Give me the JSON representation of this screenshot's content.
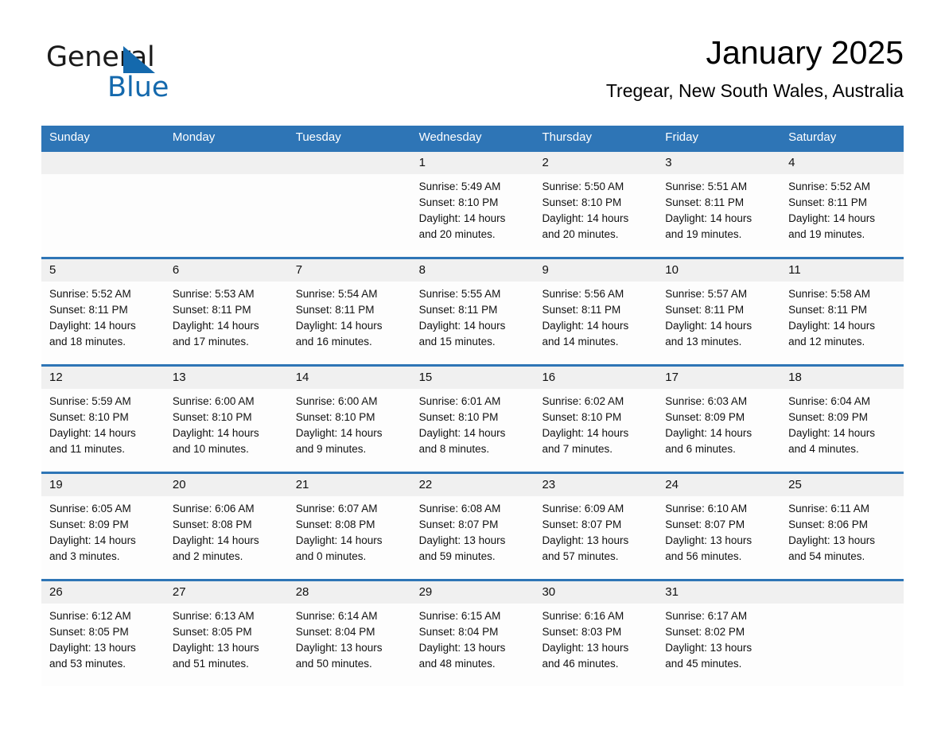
{
  "brand": {
    "name_part1": "General",
    "name_part2": "Blue",
    "triangle_color": "#1469ad"
  },
  "header": {
    "title": "January 2025",
    "location": "Tregear, New South Wales, Australia"
  },
  "theme": {
    "header_blue": "#2e75b6",
    "daynum_band": "#f0f0f0",
    "cell_bg": "#fdfdfd",
    "text": "#111111"
  },
  "weekday_headers": [
    "Sunday",
    "Monday",
    "Tuesday",
    "Wednesday",
    "Thursday",
    "Friday",
    "Saturday"
  ],
  "weeks": [
    [
      {
        "day": "",
        "lines": []
      },
      {
        "day": "",
        "lines": []
      },
      {
        "day": "",
        "lines": []
      },
      {
        "day": "1",
        "lines": [
          "Sunrise: 5:49 AM",
          "Sunset: 8:10 PM",
          "Daylight: 14 hours",
          "and 20 minutes."
        ]
      },
      {
        "day": "2",
        "lines": [
          "Sunrise: 5:50 AM",
          "Sunset: 8:10 PM",
          "Daylight: 14 hours",
          "and 20 minutes."
        ]
      },
      {
        "day": "3",
        "lines": [
          "Sunrise: 5:51 AM",
          "Sunset: 8:11 PM",
          "Daylight: 14 hours",
          "and 19 minutes."
        ]
      },
      {
        "day": "4",
        "lines": [
          "Sunrise: 5:52 AM",
          "Sunset: 8:11 PM",
          "Daylight: 14 hours",
          "and 19 minutes."
        ]
      }
    ],
    [
      {
        "day": "5",
        "lines": [
          "Sunrise: 5:52 AM",
          "Sunset: 8:11 PM",
          "Daylight: 14 hours",
          "and 18 minutes."
        ]
      },
      {
        "day": "6",
        "lines": [
          "Sunrise: 5:53 AM",
          "Sunset: 8:11 PM",
          "Daylight: 14 hours",
          "and 17 minutes."
        ]
      },
      {
        "day": "7",
        "lines": [
          "Sunrise: 5:54 AM",
          "Sunset: 8:11 PM",
          "Daylight: 14 hours",
          "and 16 minutes."
        ]
      },
      {
        "day": "8",
        "lines": [
          "Sunrise: 5:55 AM",
          "Sunset: 8:11 PM",
          "Daylight: 14 hours",
          "and 15 minutes."
        ]
      },
      {
        "day": "9",
        "lines": [
          "Sunrise: 5:56 AM",
          "Sunset: 8:11 PM",
          "Daylight: 14 hours",
          "and 14 minutes."
        ]
      },
      {
        "day": "10",
        "lines": [
          "Sunrise: 5:57 AM",
          "Sunset: 8:11 PM",
          "Daylight: 14 hours",
          "and 13 minutes."
        ]
      },
      {
        "day": "11",
        "lines": [
          "Sunrise: 5:58 AM",
          "Sunset: 8:11 PM",
          "Daylight: 14 hours",
          "and 12 minutes."
        ]
      }
    ],
    [
      {
        "day": "12",
        "lines": [
          "Sunrise: 5:59 AM",
          "Sunset: 8:10 PM",
          "Daylight: 14 hours",
          "and 11 minutes."
        ]
      },
      {
        "day": "13",
        "lines": [
          "Sunrise: 6:00 AM",
          "Sunset: 8:10 PM",
          "Daylight: 14 hours",
          "and 10 minutes."
        ]
      },
      {
        "day": "14",
        "lines": [
          "Sunrise: 6:00 AM",
          "Sunset: 8:10 PM",
          "Daylight: 14 hours",
          "and 9 minutes."
        ]
      },
      {
        "day": "15",
        "lines": [
          "Sunrise: 6:01 AM",
          "Sunset: 8:10 PM",
          "Daylight: 14 hours",
          "and 8 minutes."
        ]
      },
      {
        "day": "16",
        "lines": [
          "Sunrise: 6:02 AM",
          "Sunset: 8:10 PM",
          "Daylight: 14 hours",
          "and 7 minutes."
        ]
      },
      {
        "day": "17",
        "lines": [
          "Sunrise: 6:03 AM",
          "Sunset: 8:09 PM",
          "Daylight: 14 hours",
          "and 6 minutes."
        ]
      },
      {
        "day": "18",
        "lines": [
          "Sunrise: 6:04 AM",
          "Sunset: 8:09 PM",
          "Daylight: 14 hours",
          "and 4 minutes."
        ]
      }
    ],
    [
      {
        "day": "19",
        "lines": [
          "Sunrise: 6:05 AM",
          "Sunset: 8:09 PM",
          "Daylight: 14 hours",
          "and 3 minutes."
        ]
      },
      {
        "day": "20",
        "lines": [
          "Sunrise: 6:06 AM",
          "Sunset: 8:08 PM",
          "Daylight: 14 hours",
          "and 2 minutes."
        ]
      },
      {
        "day": "21",
        "lines": [
          "Sunrise: 6:07 AM",
          "Sunset: 8:08 PM",
          "Daylight: 14 hours",
          "and 0 minutes."
        ]
      },
      {
        "day": "22",
        "lines": [
          "Sunrise: 6:08 AM",
          "Sunset: 8:07 PM",
          "Daylight: 13 hours",
          "and 59 minutes."
        ]
      },
      {
        "day": "23",
        "lines": [
          "Sunrise: 6:09 AM",
          "Sunset: 8:07 PM",
          "Daylight: 13 hours",
          "and 57 minutes."
        ]
      },
      {
        "day": "24",
        "lines": [
          "Sunrise: 6:10 AM",
          "Sunset: 8:07 PM",
          "Daylight: 13 hours",
          "and 56 minutes."
        ]
      },
      {
        "day": "25",
        "lines": [
          "Sunrise: 6:11 AM",
          "Sunset: 8:06 PM",
          "Daylight: 13 hours",
          "and 54 minutes."
        ]
      }
    ],
    [
      {
        "day": "26",
        "lines": [
          "Sunrise: 6:12 AM",
          "Sunset: 8:05 PM",
          "Daylight: 13 hours",
          "and 53 minutes."
        ]
      },
      {
        "day": "27",
        "lines": [
          "Sunrise: 6:13 AM",
          "Sunset: 8:05 PM",
          "Daylight: 13 hours",
          "and 51 minutes."
        ]
      },
      {
        "day": "28",
        "lines": [
          "Sunrise: 6:14 AM",
          "Sunset: 8:04 PM",
          "Daylight: 13 hours",
          "and 50 minutes."
        ]
      },
      {
        "day": "29",
        "lines": [
          "Sunrise: 6:15 AM",
          "Sunset: 8:04 PM",
          "Daylight: 13 hours",
          "and 48 minutes."
        ]
      },
      {
        "day": "30",
        "lines": [
          "Sunrise: 6:16 AM",
          "Sunset: 8:03 PM",
          "Daylight: 13 hours",
          "and 46 minutes."
        ]
      },
      {
        "day": "31",
        "lines": [
          "Sunrise: 6:17 AM",
          "Sunset: 8:02 PM",
          "Daylight: 13 hours",
          "and 45 minutes."
        ]
      },
      {
        "day": "",
        "lines": []
      }
    ]
  ]
}
